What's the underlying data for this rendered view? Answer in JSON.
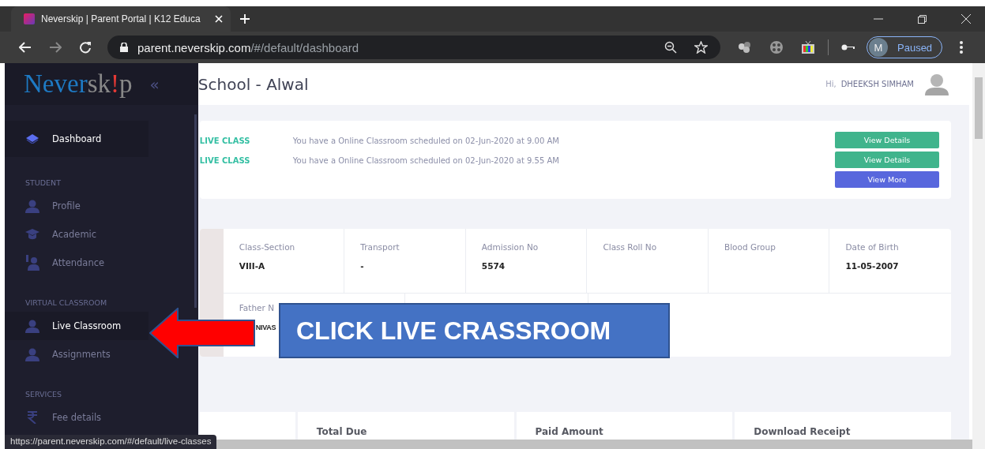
{
  "browser": {
    "tab_title": "Neverskip | Parent Portal | K12 Educa",
    "url_host": "parent.neverskip.com",
    "url_path": "/#/default/dashboard",
    "profile_initial": "M",
    "profile_status": "Paused"
  },
  "sidebar": {
    "logo": {
      "part1": "Never",
      "part2": "sk",
      "part3": "!",
      "part4": "p"
    },
    "collapse": "«",
    "groups": [
      {
        "items": [
          {
            "label": "Dashboard",
            "selected": true
          }
        ]
      },
      {
        "heading": "STUDENT",
        "items": [
          {
            "label": "Profile",
            "selected": false
          },
          {
            "label": "Academic",
            "selected": false
          },
          {
            "label": "Attendance",
            "selected": false
          }
        ]
      },
      {
        "heading": "VIRTUAL CLASSROOM",
        "items": [
          {
            "label": "Live Classroom",
            "selected": true
          },
          {
            "label": "Assignments",
            "selected": false
          }
        ]
      },
      {
        "heading": "SERVICES",
        "items": [
          {
            "label": "Fee details",
            "selected": false
          }
        ]
      }
    ]
  },
  "header": {
    "title": "School - Alwal",
    "greeting": "Hi,",
    "user": "DHEEKSH SIMHAM"
  },
  "notices": [
    {
      "tag": "LIVE CLASS",
      "text": "You have a Online Classroom scheduled on 02-Jun-2020 at 9.00 AM",
      "button": "View Details"
    },
    {
      "tag": "LIVE CLASS",
      "text": "You have a Online Classroom scheduled on 02-Jun-2020 at 9.55 AM",
      "button": "View Details"
    }
  ],
  "more_button": "View More",
  "student_info": [
    {
      "label": "Class-Section",
      "value": "VIII-A"
    },
    {
      "label": "Transport",
      "value": "-"
    },
    {
      "label": "Admission No",
      "value": "5574"
    },
    {
      "label": "Class Roll No"
    },
    {
      "label": "Blood Group"
    },
    {
      "label": "Date of Birth",
      "value": "11-05-2007"
    }
  ],
  "parent_info": {
    "label": "Father N",
    "value": "NIVAS"
  },
  "fee_cards": [
    "Total Due",
    "Paid Amount",
    "Download Receipt"
  ],
  "status_url": "https://parent.neverskip.com/#/default/live-classes",
  "callout": "CLICK LIVE CRASSROOM"
}
